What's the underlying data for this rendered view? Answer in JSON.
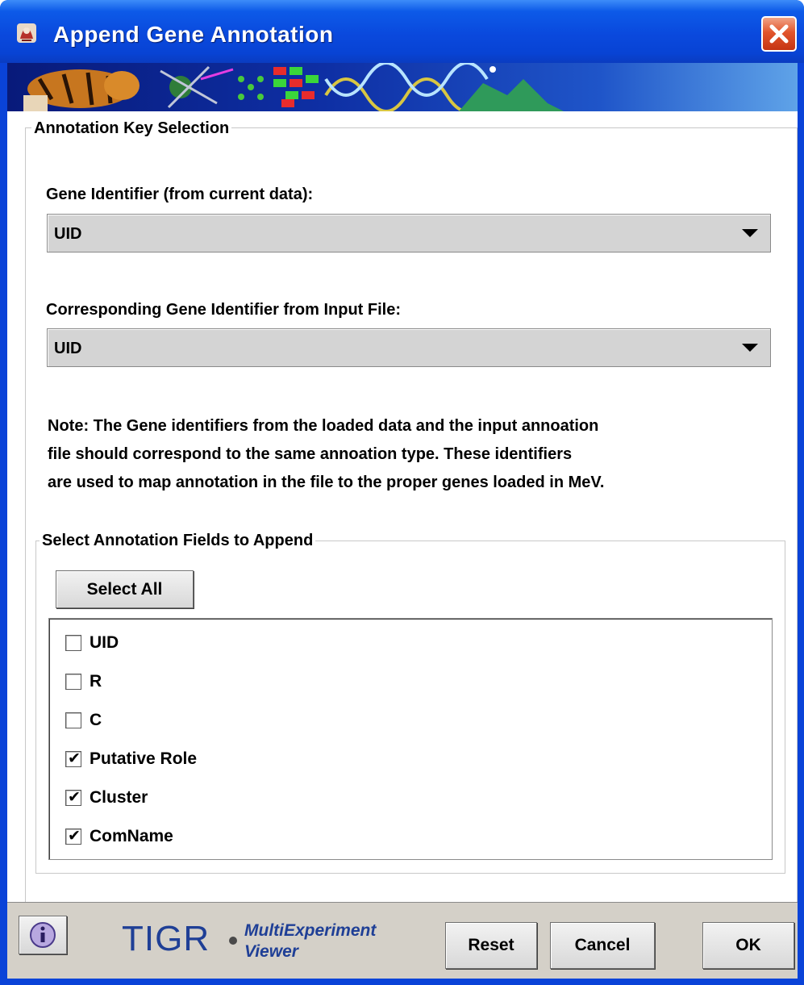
{
  "window": {
    "title": "Append Gene Annotation"
  },
  "annotation_key": {
    "legend": "Annotation Key Selection",
    "gene_id_label": "Gene Identifier (from current data):",
    "gene_id_value": "UID",
    "input_id_label": "Corresponding Gene Identifier from Input File:",
    "input_id_value": "UID",
    "note_lines": [
      "Note: The Gene identifiers from the loaded data and the input annoation",
      "file should correspond to the same annoation type. These identifiers",
      "are used to map annotation in the file to the proper genes loaded in MeV."
    ]
  },
  "fields": {
    "legend": "Select Annotation Fields to Append",
    "select_all_label": "Select All",
    "items": [
      {
        "label": "UID",
        "checked": false
      },
      {
        "label": "R",
        "checked": false
      },
      {
        "label": "C",
        "checked": false
      },
      {
        "label": "Putative Role",
        "checked": true
      },
      {
        "label": "Cluster",
        "checked": true
      },
      {
        "label": "ComName",
        "checked": true
      }
    ],
    "check_glyph": "✔"
  },
  "footer": {
    "brand": "TIGR",
    "product_line1": "MultiExperiment",
    "product_line2": "Viewer",
    "reset_label": "Reset",
    "cancel_label": "Cancel",
    "ok_label": "OK"
  },
  "colors": {
    "titlebar": "#0a49dd",
    "brand": "#1f3f96",
    "close_button": "#e2552c"
  }
}
